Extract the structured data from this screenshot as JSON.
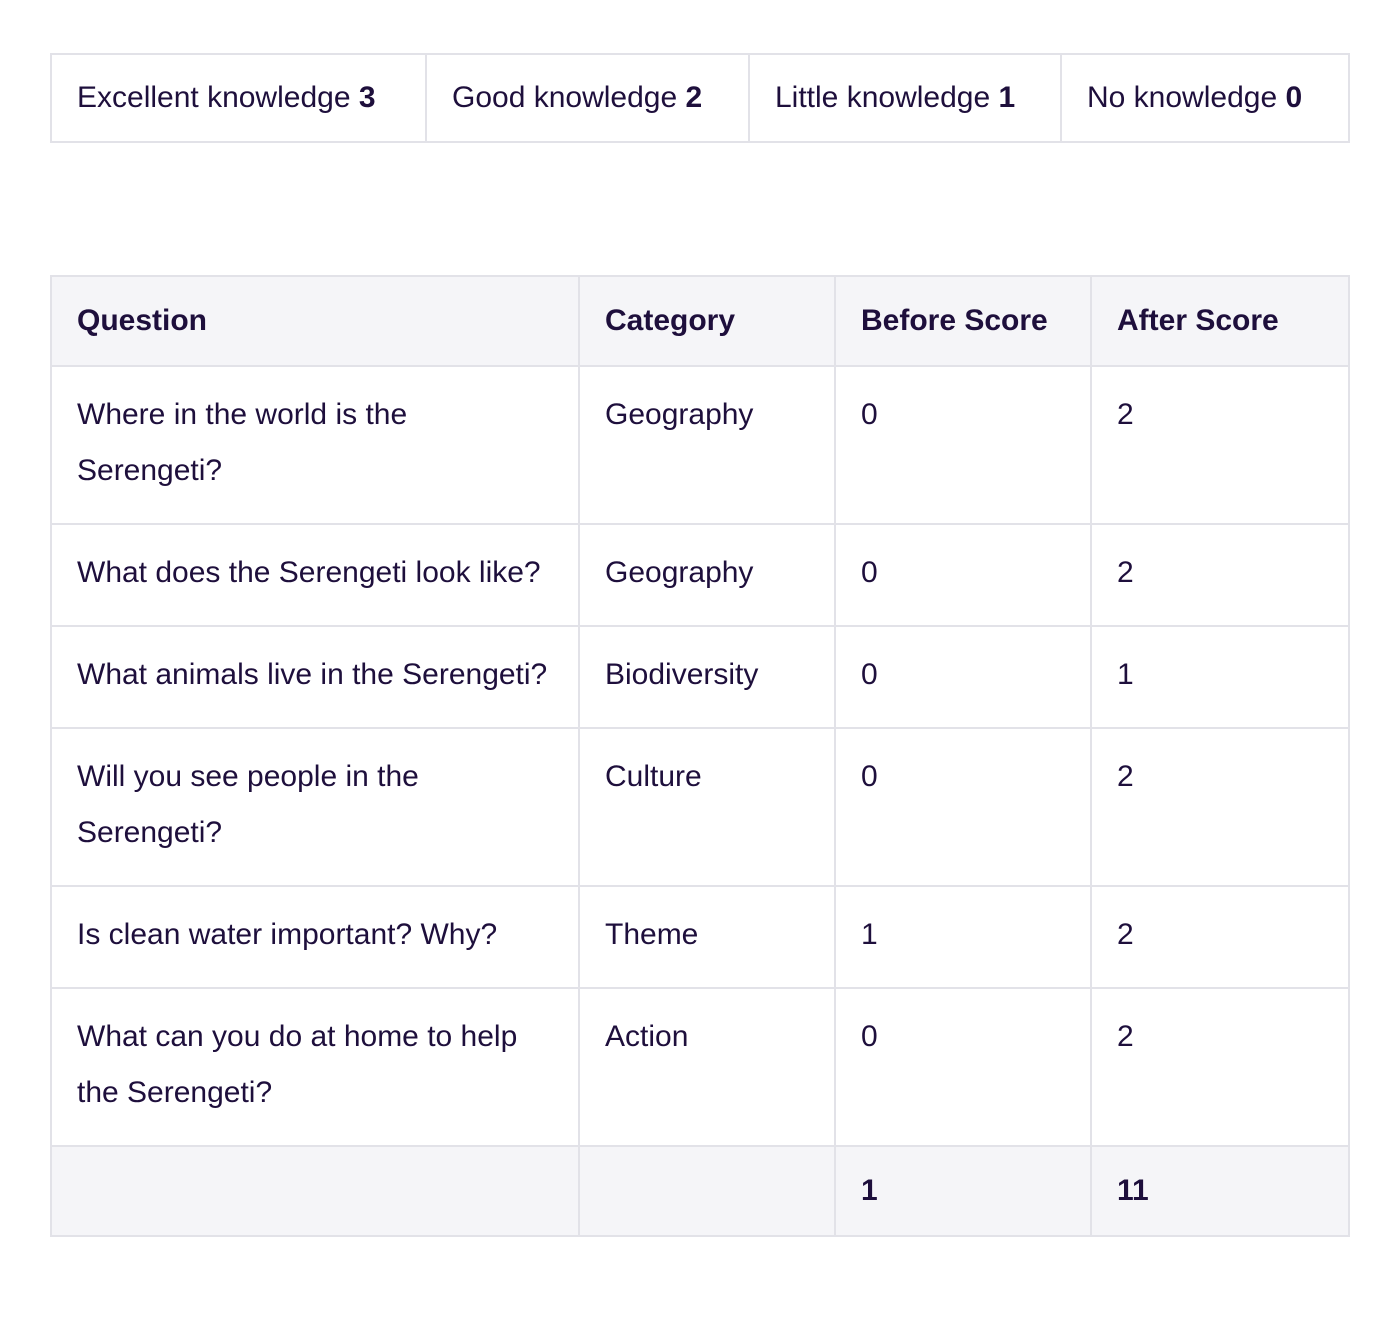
{
  "legend": {
    "items": [
      {
        "label": "Excellent knowledge",
        "value": "3"
      },
      {
        "label": "Good knowledge",
        "value": "2"
      },
      {
        "label": "Little knowledge",
        "value": "1"
      },
      {
        "label": "No knowledge",
        "value": "0"
      }
    ]
  },
  "table": {
    "headers": [
      "Question",
      "Category",
      "Before Score",
      "After Score"
    ],
    "rows": [
      {
        "question": "Where in the world is the Serengeti?",
        "category": "Geography",
        "before": "0",
        "after": "2"
      },
      {
        "question": "What does the Serengeti look like?",
        "category": "Geography",
        "before": "0",
        "after": "2"
      },
      {
        "question": "What animals live in the Serengeti?",
        "category": "Biodiversity",
        "before": "0",
        "after": "1"
      },
      {
        "question": "Will you see people in the Serengeti?",
        "category": "Culture",
        "before": "0",
        "after": "2"
      },
      {
        "question": "Is clean water important? Why?",
        "category": "Theme",
        "before": "1",
        "after": "2"
      },
      {
        "question": "What can you do at home to help the Serengeti?",
        "category": "Action",
        "before": "0",
        "after": "2"
      }
    ],
    "totals": {
      "question": "",
      "category": "",
      "before": "1",
      "after": "11"
    }
  },
  "colors": {
    "text": "#1e0f3c",
    "border": "#e2e2e8",
    "header_bg": "#f5f5f8"
  }
}
